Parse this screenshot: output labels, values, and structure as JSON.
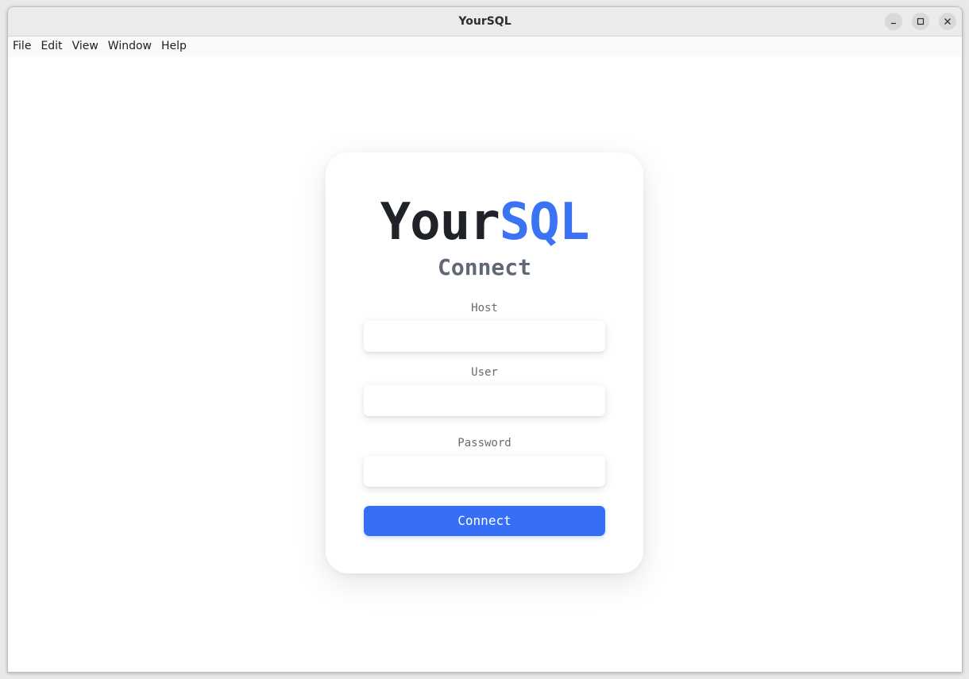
{
  "window": {
    "title": "YourSQL"
  },
  "menubar": {
    "items": [
      "File",
      "Edit",
      "View",
      "Window",
      "Help"
    ]
  },
  "login": {
    "logo_part1": "Your",
    "logo_part2": "SQL",
    "subtitle": "Connect",
    "fields": [
      {
        "label": "Host",
        "value": "",
        "placeholder": ""
      },
      {
        "label": "User",
        "value": "",
        "placeholder": ""
      },
      {
        "label": "Password",
        "value": "",
        "placeholder": ""
      }
    ],
    "connect_label": "Connect"
  },
  "colors": {
    "accent": "#366ff5",
    "logo_dark": "#1f2328",
    "logo_blue": "#3a73f3",
    "subtitle": "#5f6873"
  },
  "icons": {
    "minimize": "minimize-icon",
    "maximize": "maximize-icon",
    "close": "close-icon"
  }
}
